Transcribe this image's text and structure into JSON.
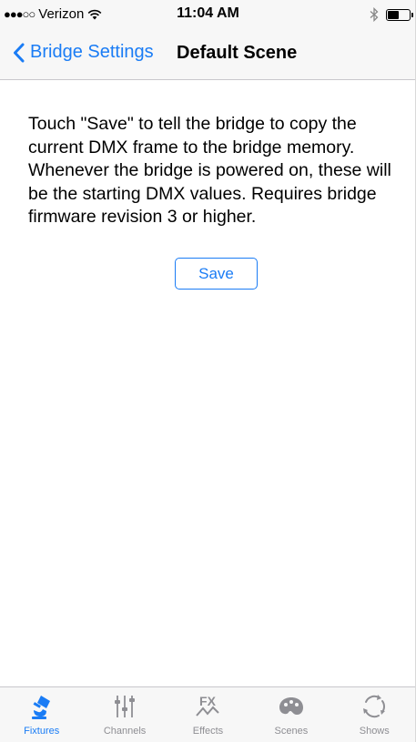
{
  "status_bar": {
    "carrier": "Verizon",
    "time": "11:04 AM"
  },
  "nav": {
    "back_label": "Bridge Settings",
    "title": "Default Scene"
  },
  "content": {
    "description": "Touch \"Save\" to tell the bridge to copy the current DMX frame to the bridge memory. Whenever the bridge is powered on, these will be the starting DMX values. Requires bridge firmware revision 3 or higher.",
    "save_label": "Save"
  },
  "tabs": [
    {
      "label": "Fixtures",
      "icon": "fixtures-icon",
      "active": true
    },
    {
      "label": "Channels",
      "icon": "channels-icon",
      "active": false
    },
    {
      "label": "Effects",
      "icon": "effects-icon",
      "active": false
    },
    {
      "label": "Scenes",
      "icon": "scenes-icon",
      "active": false
    },
    {
      "label": "Shows",
      "icon": "shows-icon",
      "active": false
    }
  ],
  "colors": {
    "accent": "#1a7cf5",
    "inactive": "#8e8e93",
    "bar_background": "#f7f7f7"
  }
}
